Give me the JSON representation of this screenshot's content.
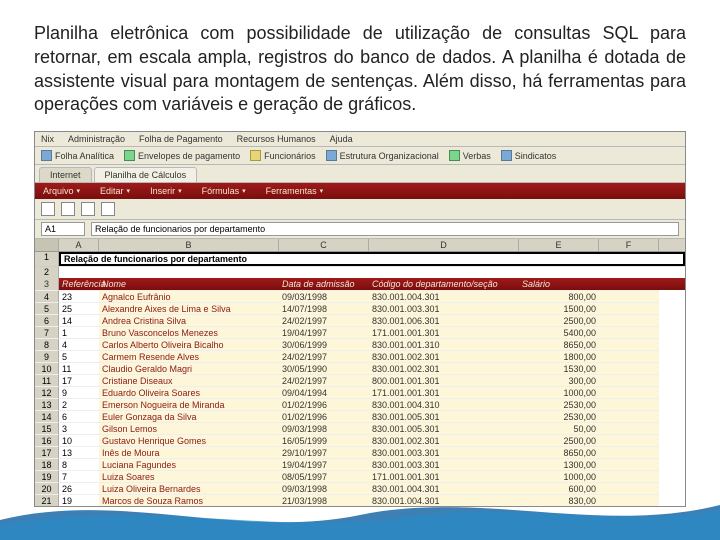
{
  "description": "Planilha eletrônica com possibilidade de utilização de consultas SQL para retornar, em escala ampla, registros do banco de dados. A planilha é dotada de assistente visual para montagem de sentenças. Além disso, há ferramentas para operações com variáveis e geração de gráficos.",
  "menubar": {
    "items": [
      "Nix",
      "Administração",
      "Folha de Pagamento",
      "Recursos Humanos",
      "Ajuda"
    ]
  },
  "toolbar": {
    "items": [
      "Folha Analítica",
      "Envelopes de pagamento",
      "Funcionários",
      "Estrutura Organizacional",
      "Verbas",
      "Sindicatos"
    ]
  },
  "tabs": {
    "active": "Planilha de Cálculos",
    "inactive": "Internet"
  },
  "redmenu": {
    "items": [
      "Arquivo",
      "Editar",
      "Inserir",
      "Fórmulas",
      "Ferramentas"
    ]
  },
  "formula": {
    "cell": "A1",
    "value": "Relação de funcionarios por departamento"
  },
  "columns": [
    "",
    "A",
    "B",
    "C",
    "D",
    "E",
    "F"
  ],
  "titlecell": {
    "row": "1",
    "text": "Relação de funcionarios por departamento"
  },
  "emptyrows": [
    "2"
  ],
  "header": {
    "row": "3",
    "ref": "Referência",
    "name": "Nome",
    "date": "Data de admissão",
    "dept": "Código do departamento/seção",
    "salary": "Salário"
  },
  "rows": [
    {
      "rn": "4",
      "ref": "23",
      "name": "Agnalco Eufrânio",
      "date": "09/03/1998",
      "dept": "830.001.004.301",
      "sal": "800,00"
    },
    {
      "rn": "5",
      "ref": "25",
      "name": "Alexandre Aixes de Lima e Silva",
      "date": "14/07/1998",
      "dept": "830.001.003.301",
      "sal": "1500,00"
    },
    {
      "rn": "6",
      "ref": "14",
      "name": "Andrea Cristina Silva",
      "date": "24/02/1997",
      "dept": "830.001.006.301",
      "sal": "2500,00"
    },
    {
      "rn": "7",
      "ref": "1",
      "name": "Bruno Vasconcelos Menezes",
      "date": "19/04/1997",
      "dept": "171.001.001.301",
      "sal": "5400,00"
    },
    {
      "rn": "8",
      "ref": "4",
      "name": "Carlos Alberto Oliveira Bicalho",
      "date": "30/06/1999",
      "dept": "830.001.001.310",
      "sal": "8650,00"
    },
    {
      "rn": "9",
      "ref": "5",
      "name": "Carmem Resende Alves",
      "date": "24/02/1997",
      "dept": "830.001.002.301",
      "sal": "1800,00"
    },
    {
      "rn": "10",
      "ref": "11",
      "name": "Claudio Geraldo Magri",
      "date": "30/05/1990",
      "dept": "830.001.002.301",
      "sal": "1530,00"
    },
    {
      "rn": "11",
      "ref": "17",
      "name": "Cristiane Diseaux",
      "date": "24/02/1997",
      "dept": "800.001.001.301",
      "sal": "300,00"
    },
    {
      "rn": "12",
      "ref": "9",
      "name": "Eduardo Oliveira Soares",
      "date": "09/04/1994",
      "dept": "171.001.001.301",
      "sal": "1000,00"
    },
    {
      "rn": "13",
      "ref": "2",
      "name": "Emerson Nogueira de Miranda",
      "date": "01/02/1996",
      "dept": "830.001.004.310",
      "sal": "2530,00"
    },
    {
      "rn": "14",
      "ref": "6",
      "name": "Euler Gonzaga da Silva",
      "date": "01/02/1996",
      "dept": "830.001.005.301",
      "sal": "2530,00"
    },
    {
      "rn": "15",
      "ref": "3",
      "name": "Gilson Lemos",
      "date": "09/03/1998",
      "dept": "830.001.005.301",
      "sal": "50,00"
    },
    {
      "rn": "16",
      "ref": "10",
      "name": "Gustavo Henrique Gomes",
      "date": "16/05/1999",
      "dept": "830.001.002.301",
      "sal": "2500,00"
    },
    {
      "rn": "17",
      "ref": "13",
      "name": "Inês de Moura",
      "date": "29/10/1997",
      "dept": "830.001.003.301",
      "sal": "8650,00"
    },
    {
      "rn": "18",
      "ref": "8",
      "name": "Luciana Fagundes",
      "date": "19/04/1997",
      "dept": "830.001.003.301",
      "sal": "1300,00"
    },
    {
      "rn": "19",
      "ref": "7",
      "name": "Luiza Soares",
      "date": "08/05/1997",
      "dept": "171.001.001.301",
      "sal": "1000,00"
    },
    {
      "rn": "20",
      "ref": "26",
      "name": "Luiza Oliveira Bernardes",
      "date": "09/03/1998",
      "dept": "830.001.004.301",
      "sal": "600,00"
    },
    {
      "rn": "21",
      "ref": "19",
      "name": "Marcos de Souza Ramos",
      "date": "21/03/1998",
      "dept": "830.001.004.301",
      "sal": "830,00"
    }
  ]
}
